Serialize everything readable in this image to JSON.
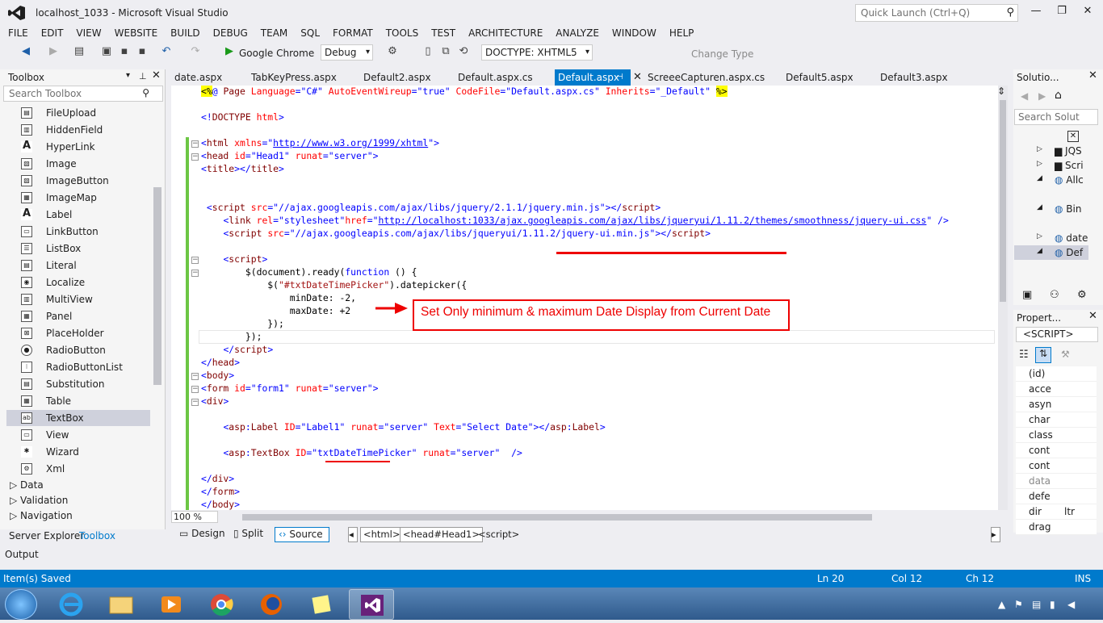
{
  "window": {
    "title": "localhost_1033 - Microsoft Visual Studio",
    "quick_launch": "Quick Launch (Ctrl+Q)"
  },
  "menu": [
    "FILE",
    "EDIT",
    "VIEW",
    "WEBSITE",
    "BUILD",
    "DEBUG",
    "TEAM",
    "SQL",
    "FORMAT",
    "TOOLS",
    "TEST",
    "ARCHITECTURE",
    "ANALYZE",
    "WINDOW",
    "HELP"
  ],
  "toolbar": {
    "browser": "Google Chrome",
    "config": "Debug",
    "doctype": "DOCTYPE: XHTML5",
    "change_type": "Change Type"
  },
  "toolbox": {
    "title": "Toolbox",
    "search": "Search Toolbox",
    "items": [
      {
        "label": "FileUpload",
        "icon": "file-upload-icon"
      },
      {
        "label": "HiddenField",
        "icon": "hidden-field-icon"
      },
      {
        "label": "HyperLink",
        "icon": "hyperlink-icon"
      },
      {
        "label": "Image",
        "icon": "image-icon"
      },
      {
        "label": "ImageButton",
        "icon": "image-button-icon"
      },
      {
        "label": "ImageMap",
        "icon": "image-map-icon"
      },
      {
        "label": "Label",
        "icon": "label-icon"
      },
      {
        "label": "LinkButton",
        "icon": "link-button-icon"
      },
      {
        "label": "ListBox",
        "icon": "listbox-icon"
      },
      {
        "label": "Literal",
        "icon": "literal-icon"
      },
      {
        "label": "Localize",
        "icon": "localize-icon"
      },
      {
        "label": "MultiView",
        "icon": "multiview-icon"
      },
      {
        "label": "Panel",
        "icon": "panel-icon"
      },
      {
        "label": "PlaceHolder",
        "icon": "placeholder-icon"
      },
      {
        "label": "RadioButton",
        "icon": "radio-button-icon"
      },
      {
        "label": "RadioButtonList",
        "icon": "radio-button-list-icon"
      },
      {
        "label": "Substitution",
        "icon": "substitution-icon"
      },
      {
        "label": "Table",
        "icon": "table-icon"
      },
      {
        "label": "TextBox",
        "icon": "textbox-icon"
      },
      {
        "label": "View",
        "icon": "view-icon"
      },
      {
        "label": "Wizard",
        "icon": "wizard-icon"
      },
      {
        "label": "Xml",
        "icon": "xml-icon"
      }
    ],
    "groups": [
      "Data",
      "Validation",
      "Navigation"
    ],
    "bottom_tabs": [
      "Server Explorer",
      "Toolbox"
    ]
  },
  "tabs": [
    "date.aspx",
    "TabKeyPress.aspx",
    "Default2.aspx",
    "Default.aspx.cs",
    "Default.aspx",
    "ScreeeCapturen.aspx.cs",
    "Default5.aspx",
    "Default3.aspx"
  ],
  "annotation": "Set Only minimum & maximum Date Display from Current Date",
  "zoom": "100 %",
  "view": {
    "design": "Design",
    "split": "Split",
    "source": "Source"
  },
  "breadcrumbs": [
    "<html>",
    "<head#Head1>",
    "<script>"
  ],
  "solution": {
    "title": "Solutio...",
    "search": "Search Solut",
    "items": [
      "JQS",
      "Scri",
      "Allc",
      "Bin",
      "date",
      "Def"
    ]
  },
  "properties": {
    "title": "Propert...",
    "selected": "<SCRIPT>",
    "rows": [
      {
        "name": "(id)",
        "value": ""
      },
      {
        "name": "acce",
        "value": ""
      },
      {
        "name": "asyn",
        "value": ""
      },
      {
        "name": "char",
        "value": ""
      },
      {
        "name": "class",
        "value": ""
      },
      {
        "name": "cont",
        "value": ""
      },
      {
        "name": "cont",
        "value": ""
      },
      {
        "name": "data",
        "value": ""
      },
      {
        "name": "defe",
        "value": ""
      },
      {
        "name": "dir",
        "value": "ltr"
      },
      {
        "name": "drag",
        "value": ""
      }
    ]
  },
  "output": "Output",
  "status": {
    "message": "Item(s) Saved",
    "ln": "Ln 20",
    "col": "Col 12",
    "ch": "Ch 12",
    "mode": "INS"
  },
  "colors": {
    "accent": "#007acc",
    "annotation": "#e00000",
    "changed": "#6cc644"
  }
}
